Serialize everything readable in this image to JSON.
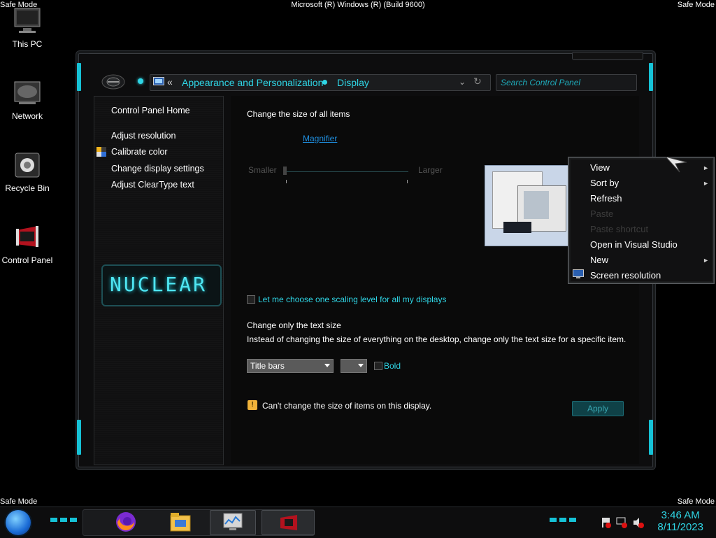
{
  "desktop": {
    "safe_mode": "Safe Mode",
    "build_text": "Microsoft (R) Windows (R) (Build 9600)",
    "icons": [
      {
        "label": "This PC",
        "icon": "monitor-icon"
      },
      {
        "label": "Network",
        "icon": "network-icon"
      },
      {
        "label": "Recycle Bin",
        "icon": "recycle-bin-icon"
      },
      {
        "label": "Control Panel",
        "icon": "control-panel-icon"
      }
    ]
  },
  "window": {
    "breadcrumb": {
      "prefix": "«",
      "items": [
        "Appearance and Personalization",
        "Display"
      ]
    },
    "search_placeholder": "Search Control Panel",
    "nav": {
      "home": "Control Panel Home",
      "links": [
        "Adjust resolution",
        "Calibrate color",
        "Change display settings",
        "Adjust ClearType text"
      ],
      "logo_text": "NUCLEAR"
    },
    "content": {
      "heading_all_items": "Change the size of all items",
      "magnifier_link": "Magnifier",
      "slider_smaller": "Smaller",
      "slider_larger": "Larger",
      "scaling_checkbox": "Let me choose one scaling level for all my displays",
      "text_size_heading": "Change only the text size",
      "text_size_desc": "Instead of changing the size of everything on the desktop, change only the text size for a specific item.",
      "item_select_value": "Title bars",
      "size_select_value": "",
      "bold_label": "Bold",
      "warning_text": "Can't change the size of items on this display.",
      "apply_label": "Apply"
    }
  },
  "context_menu": {
    "items": [
      {
        "label": "View",
        "submenu": true,
        "disabled": false
      },
      {
        "label": "Sort by",
        "submenu": true,
        "disabled": false
      },
      {
        "label": "Refresh",
        "submenu": false,
        "disabled": false
      },
      {
        "label": "Paste",
        "submenu": false,
        "disabled": true
      },
      {
        "label": "Paste shortcut",
        "submenu": false,
        "disabled": true
      },
      {
        "label": "Open in Visual Studio",
        "submenu": false,
        "disabled": false
      },
      {
        "label": "New",
        "submenu": true,
        "disabled": false
      },
      {
        "label": "Screen resolution",
        "submenu": false,
        "disabled": false
      }
    ]
  },
  "taskbar": {
    "time": "3:46 AM",
    "date": "8/11/2023"
  },
  "colors": {
    "accent": "#2fd6e6",
    "background": "#000000",
    "panel": "#121213"
  }
}
